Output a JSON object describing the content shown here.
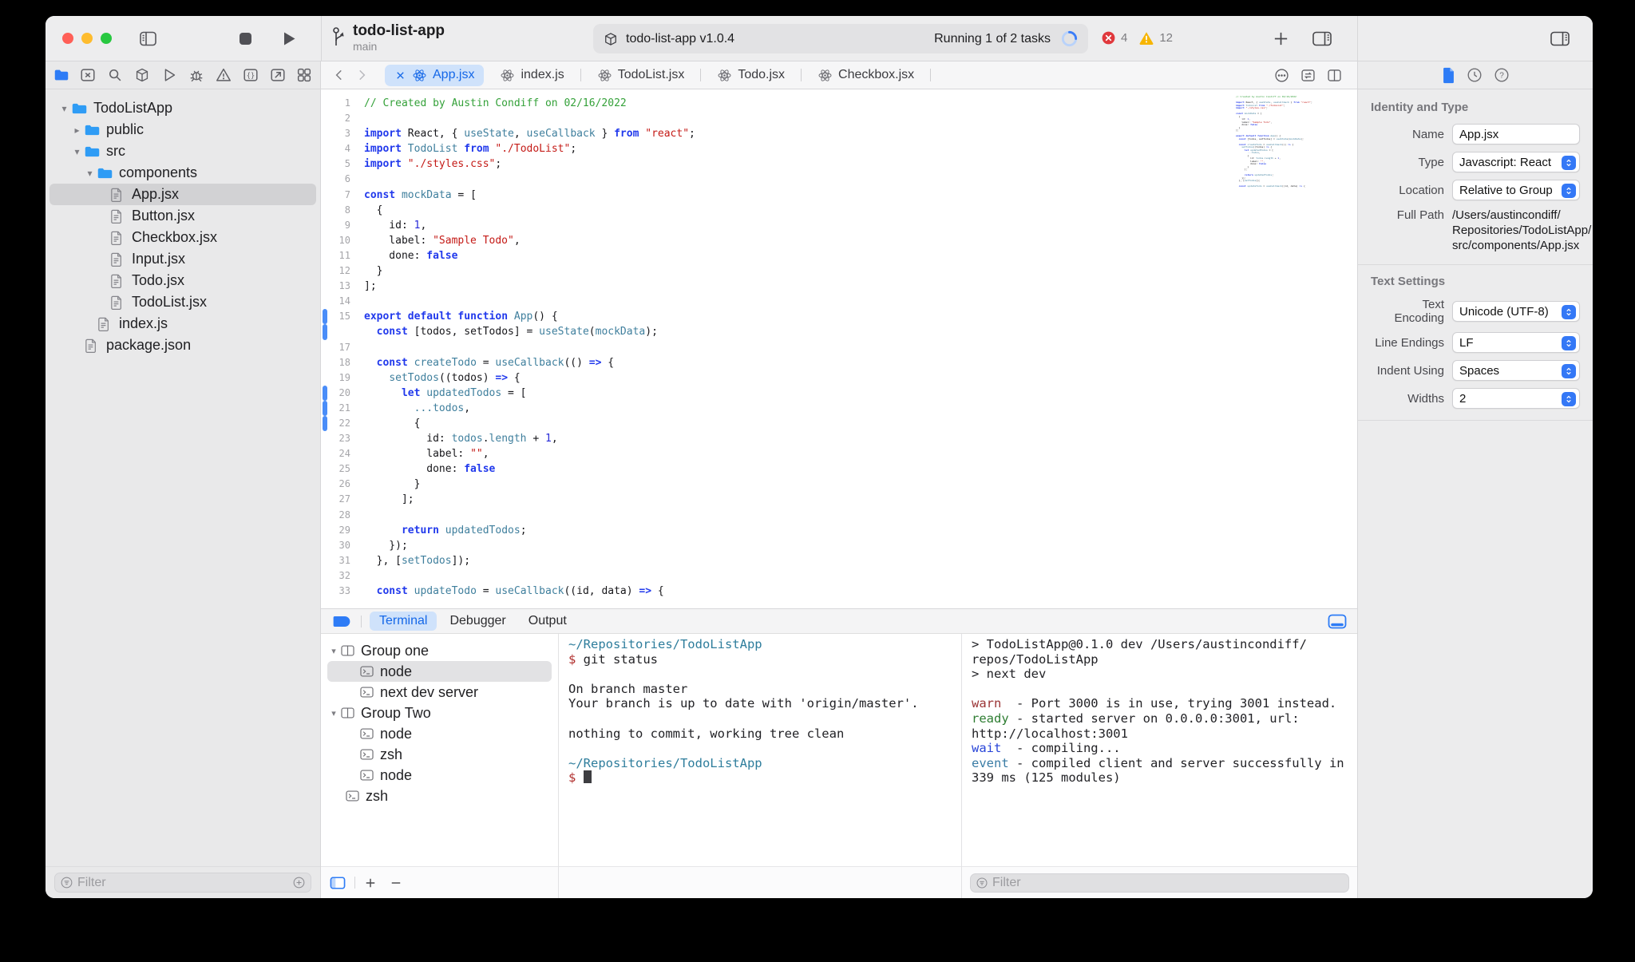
{
  "colors": {
    "accent": "#3478f6",
    "error_badge": "#e0383c",
    "warning_badge": "#f7b500",
    "active_tab_bg": "#cfe2fb",
    "active_tab_text": "#1467e8",
    "selection": "#d2d2d4",
    "changed_line_bar": "#4a8df8"
  },
  "toolbar": {
    "project": "todo-list-app",
    "branch": "main",
    "status_app": "todo-list-app v1.0.4",
    "status_running": "Running 1 of 2 tasks",
    "error_count": "4",
    "warning_count": "12"
  },
  "navigator": {
    "filter_placeholder": "Filter",
    "files": [
      {
        "label": "TodoListApp",
        "level": 0,
        "type": "folder",
        "chevron": "down"
      },
      {
        "label": "public",
        "level": 1,
        "type": "folder",
        "chevron": "right"
      },
      {
        "label": "src",
        "level": 1,
        "type": "folder",
        "chevron": "down"
      },
      {
        "label": "components",
        "level": 2,
        "type": "folder",
        "chevron": "down"
      },
      {
        "label": "App.jsx",
        "level": 3,
        "type": "file",
        "selected": true
      },
      {
        "label": "Button.jsx",
        "level": 3,
        "type": "file"
      },
      {
        "label": "Checkbox.jsx",
        "level": 3,
        "type": "file"
      },
      {
        "label": "Input.jsx",
        "level": 3,
        "type": "file"
      },
      {
        "label": "Todo.jsx",
        "level": 3,
        "type": "file"
      },
      {
        "label": "TodoList.jsx",
        "level": 3,
        "type": "file"
      },
      {
        "label": "index.js",
        "level": 2,
        "type": "file"
      },
      {
        "label": "package.json",
        "level": 1,
        "type": "file"
      }
    ]
  },
  "tabs": {
    "items": [
      {
        "label": "App.jsx",
        "active": true
      },
      {
        "label": "index.js"
      },
      {
        "label": "TodoList.jsx"
      },
      {
        "label": "Todo.jsx"
      },
      {
        "label": "Checkbox.jsx"
      }
    ]
  },
  "editor": {
    "lines": [
      {
        "n": "1",
        "tk": [
          [
            "c",
            "// Created by Austin Condiff on 02/16/2022"
          ]
        ]
      },
      {
        "n": "2",
        "tk": []
      },
      {
        "n": "3",
        "tk": [
          [
            "k",
            "import"
          ],
          [
            "p",
            " React, { "
          ],
          [
            "i",
            "useState"
          ],
          [
            "p",
            ", "
          ],
          [
            "i",
            "useCallback"
          ],
          [
            "p",
            " } "
          ],
          [
            "k",
            "from"
          ],
          [
            "p",
            " "
          ],
          [
            "s",
            "\"react\""
          ],
          [
            "p",
            ";"
          ]
        ]
      },
      {
        "n": "4",
        "tk": [
          [
            "k",
            "import"
          ],
          [
            "p",
            " "
          ],
          [
            "i",
            "TodoList"
          ],
          [
            "p",
            " "
          ],
          [
            "k",
            "from"
          ],
          [
            "p",
            " "
          ],
          [
            "s",
            "\"./TodoList\""
          ],
          [
            "p",
            ";"
          ]
        ]
      },
      {
        "n": "5",
        "tk": [
          [
            "k",
            "import"
          ],
          [
            "p",
            " "
          ],
          [
            "s",
            "\"./styles.css\""
          ],
          [
            "p",
            ";"
          ]
        ]
      },
      {
        "n": "6",
        "tk": []
      },
      {
        "n": "7",
        "tk": [
          [
            "k",
            "const"
          ],
          [
            "p",
            " "
          ],
          [
            "i",
            "mockData"
          ],
          [
            "p",
            " = ["
          ]
        ]
      },
      {
        "n": "8",
        "tk": [
          [
            "p",
            "  {"
          ]
        ]
      },
      {
        "n": "9",
        "tk": [
          [
            "p",
            "    id: "
          ],
          [
            "n2",
            "1"
          ],
          [
            "p",
            ","
          ]
        ]
      },
      {
        "n": "10",
        "tk": [
          [
            "p",
            "    label: "
          ],
          [
            "s",
            "\"Sample Todo\""
          ],
          [
            "p",
            ","
          ]
        ]
      },
      {
        "n": "11",
        "tk": [
          [
            "p",
            "    done: "
          ],
          [
            "k",
            "false"
          ]
        ]
      },
      {
        "n": "12",
        "tk": [
          [
            "p",
            "  }"
          ]
        ]
      },
      {
        "n": "13",
        "tk": [
          [
            "p",
            "];"
          ]
        ]
      },
      {
        "n": "14",
        "tk": []
      },
      {
        "n": "15",
        "ch": true,
        "tk": [
          [
            "k",
            "export"
          ],
          [
            "p",
            " "
          ],
          [
            "k",
            "default"
          ],
          [
            "p",
            " "
          ],
          [
            "k",
            "function"
          ],
          [
            "p",
            " "
          ],
          [
            "i",
            "App"
          ],
          [
            "p",
            "() {"
          ]
        ]
      },
      {
        "n": "",
        "ch": true,
        "tk": [
          [
            "p",
            "  "
          ],
          [
            "k",
            "const"
          ],
          [
            "p",
            " [todos, setTodos] = "
          ],
          [
            "i",
            "useState"
          ],
          [
            "p",
            "("
          ],
          [
            "i",
            "mockData"
          ],
          [
            "p",
            ");"
          ]
        ]
      },
      {
        "n": "17",
        "tk": []
      },
      {
        "n": "18",
        "tk": [
          [
            "p",
            "  "
          ],
          [
            "k",
            "const"
          ],
          [
            "p",
            " "
          ],
          [
            "i",
            "createTodo"
          ],
          [
            "p",
            " = "
          ],
          [
            "i",
            "useCallback"
          ],
          [
            "p",
            "(() "
          ],
          [
            "k",
            "=>"
          ],
          [
            "p",
            " {"
          ]
        ]
      },
      {
        "n": "19",
        "tk": [
          [
            "p",
            "    "
          ],
          [
            "i",
            "setTodos"
          ],
          [
            "p",
            "((todos) "
          ],
          [
            "k",
            "=>"
          ],
          [
            "p",
            " {"
          ]
        ]
      },
      {
        "n": "20",
        "ch": true,
        "tk": [
          [
            "p",
            "      "
          ],
          [
            "k",
            "let"
          ],
          [
            "p",
            " "
          ],
          [
            "i",
            "updatedTodos"
          ],
          [
            "p",
            " = ["
          ]
        ]
      },
      {
        "n": "21",
        "ch": true,
        "tk": [
          [
            "p",
            "        "
          ],
          [
            "i",
            "...todos"
          ],
          [
            "p",
            ","
          ]
        ]
      },
      {
        "n": "22",
        "ch": true,
        "tk": [
          [
            "p",
            "        {"
          ]
        ]
      },
      {
        "n": "23",
        "tk": [
          [
            "p",
            "          id: "
          ],
          [
            "i",
            "todos"
          ],
          [
            "p",
            "."
          ],
          [
            "i",
            "length"
          ],
          [
            "p",
            " + "
          ],
          [
            "n2",
            "1"
          ],
          [
            "p",
            ","
          ]
        ]
      },
      {
        "n": "24",
        "tk": [
          [
            "p",
            "          label: "
          ],
          [
            "s",
            "\"\""
          ],
          [
            "p",
            ","
          ]
        ]
      },
      {
        "n": "25",
        "tk": [
          [
            "p",
            "          done: "
          ],
          [
            "k",
            "false"
          ]
        ]
      },
      {
        "n": "26",
        "tk": [
          [
            "p",
            "        }"
          ]
        ]
      },
      {
        "n": "27",
        "tk": [
          [
            "p",
            "      ];"
          ]
        ]
      },
      {
        "n": "28",
        "tk": []
      },
      {
        "n": "29",
        "tk": [
          [
            "p",
            "      "
          ],
          [
            "k",
            "return"
          ],
          [
            "p",
            " "
          ],
          [
            "i",
            "updatedTodos"
          ],
          [
            "p",
            ";"
          ]
        ]
      },
      {
        "n": "30",
        "tk": [
          [
            "p",
            "    });"
          ]
        ]
      },
      {
        "n": "31",
        "tk": [
          [
            "p",
            "  }, ["
          ],
          [
            "i",
            "setTodos"
          ],
          [
            "p",
            "]);"
          ]
        ]
      },
      {
        "n": "32",
        "tk": []
      },
      {
        "n": "33",
        "tk": [
          [
            "p",
            "  "
          ],
          [
            "k",
            "const"
          ],
          [
            "p",
            " "
          ],
          [
            "i",
            "updateTodo"
          ],
          [
            "p",
            " = "
          ],
          [
            "i",
            "useCallback"
          ],
          [
            "p",
            "((id, data) "
          ],
          [
            "k",
            "=>"
          ],
          [
            "p",
            " {"
          ]
        ]
      }
    ]
  },
  "inspector": {
    "identity_header": "Identity and Type",
    "name_label": "Name",
    "name_value": "App.jsx",
    "type_label": "Type",
    "type_value": "Javascript: React",
    "location_label": "Location",
    "location_value": "Relative to Group",
    "fullpath_label": "Full Path",
    "fullpath_value": "/Users/austincondiff/\nRepositories/TodoListApp/\nsrc/components/App.jsx",
    "text_header": "Text Settings",
    "encoding_label": "Text Encoding",
    "encoding_value": "Unicode (UTF-8)",
    "lineendings_label": "Line Endings",
    "lineendings_value": "LF",
    "indent_label": "Indent Using",
    "indent_value": "Spaces",
    "widths_label": "Widths",
    "widths_value": "2"
  },
  "terminal": {
    "tabs": [
      {
        "label": "Terminal",
        "active": true
      },
      {
        "label": "Debugger"
      },
      {
        "label": "Output"
      }
    ],
    "filter_placeholder": "Filter",
    "groups": [
      {
        "label": "Group one",
        "type": "group",
        "chevron": "down"
      },
      {
        "label": "node",
        "type": "term",
        "level": 1,
        "selected": true
      },
      {
        "label": "next dev server",
        "type": "term",
        "level": 1
      },
      {
        "label": "Group Two",
        "type": "group",
        "chevron": "down"
      },
      {
        "label": "node",
        "type": "term",
        "level": 1
      },
      {
        "label": "zsh",
        "type": "term",
        "level": 1
      },
      {
        "label": "node",
        "type": "term",
        "level": 1
      },
      {
        "label": "zsh",
        "type": "term",
        "level": 0
      }
    ],
    "middle": [
      [
        [
          "path",
          "~/Repositories/TodoListApp"
        ]
      ],
      [
        [
          "dol",
          "$"
        ],
        [
          "pl",
          " git status"
        ]
      ],
      [],
      [
        [
          "pl",
          "On branch master"
        ]
      ],
      [
        [
          "pl",
          "Your branch is up to date with 'origin/master'."
        ]
      ],
      [],
      [
        [
          "pl",
          "nothing to commit, working tree clean"
        ]
      ],
      [],
      [
        [
          "path",
          "~/Repositories/TodoListApp"
        ]
      ],
      [
        [
          "dol",
          "$ "
        ],
        [
          "cur",
          " "
        ]
      ]
    ],
    "right": [
      [
        [
          "pl",
          "> TodoListApp@0.1.0 dev /Users/austincondiff/"
        ]
      ],
      [
        [
          "pl",
          "repos/TodoListApp"
        ]
      ],
      [
        [
          "pl",
          "> next dev"
        ]
      ],
      [],
      [
        [
          "warn",
          "warn"
        ],
        [
          "pl",
          "  - Port 3000 is in use, trying 3001 instead."
        ]
      ],
      [
        [
          "ready",
          "ready"
        ],
        [
          "pl",
          " - started server on 0.0.0.0:3001, url:"
        ]
      ],
      [
        [
          "pl",
          "http://localhost:3001"
        ]
      ],
      [
        [
          "wait",
          "wait"
        ],
        [
          "pl",
          "  - compiling..."
        ]
      ],
      [
        [
          "event",
          "event"
        ],
        [
          "pl",
          " - compiled client and server successfully in"
        ]
      ],
      [
        [
          "pl",
          "339 ms (125 modules)"
        ]
      ]
    ]
  }
}
